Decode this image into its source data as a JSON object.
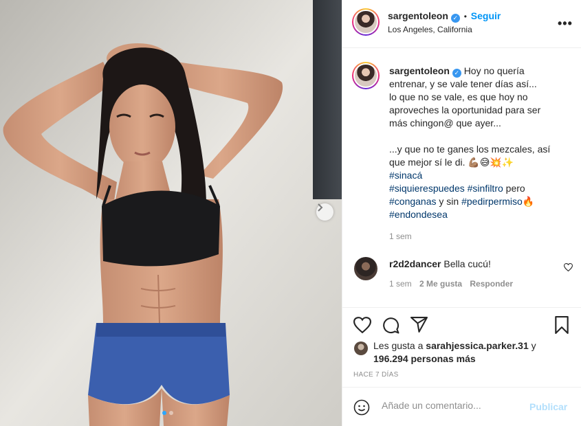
{
  "post": {
    "username": "sargentoleon",
    "verified_glyph": "✓",
    "follow_separator": "•",
    "follow_label": "Seguir",
    "location": "Los Angeles, California",
    "more_label": "•••",
    "photo_icon": "next-arrow-icon",
    "carousel": {
      "count": 2,
      "active": 1
    }
  },
  "caption": {
    "username": "sargentoleon",
    "lines": [
      "Hoy no quería",
      "entrenar, y se vale tener días así...",
      "lo que no se vale, es que hoy no",
      "aproveches la oportunidad para ser",
      "más chingon@ que ayer...",
      "...y que no te ganes los mezcales, así",
      "que mejor sí le di. 💪🏽😅💥✨"
    ],
    "hashtags": {
      "h1": "#sinacá",
      "h2": "#siquierespuedes",
      "h3": "#sinfiltro",
      "w1": " pero",
      "h4": "#conganas",
      "w2": " y sin ",
      "h5": "#pedirpermiso",
      "fire": "🔥",
      "h6": "#endondesea"
    },
    "time": "1 sem"
  },
  "comment": {
    "username": "r2d2dancer",
    "text": "Bella cucú!",
    "time": "1 sem",
    "likes": "2 Me gusta",
    "reply": "Responder"
  },
  "actions": {
    "likes_prefix": "Les gusta a ",
    "likes_user": "sarahjessica.parker.31",
    "likes_join": " y",
    "likes_count": "196.294 personas más",
    "ago": "HACE 7 DÍAS"
  },
  "add_comment": {
    "placeholder": "Añade un comentario...",
    "publish": "Publicar",
    "emoji_icon": "emoji-icon"
  },
  "colors": {
    "link": "#0095f6",
    "hashtag": "#00376b",
    "muted": "#8e8e8e",
    "publish_disabled": "#b2dffc"
  }
}
